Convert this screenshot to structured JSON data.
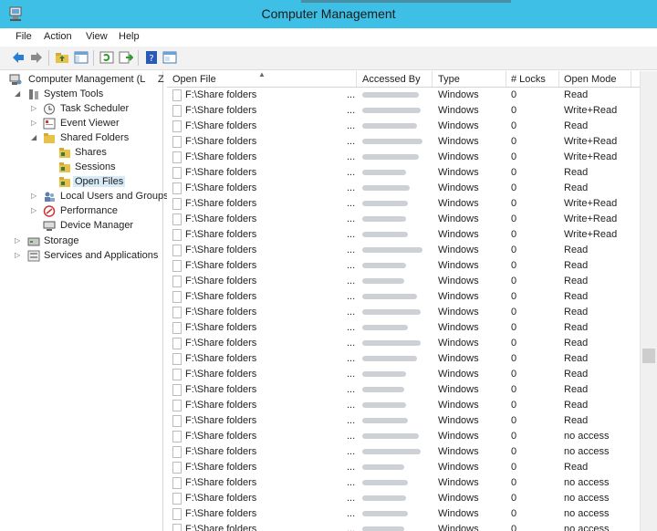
{
  "window": {
    "title": "Computer Management"
  },
  "menu": [
    "File",
    "Action",
    "View",
    "Help"
  ],
  "toolbar": {
    "icons": [
      "back-arrow-icon",
      "forward-arrow-icon",
      "up-folder-icon",
      "show-hide-tree-icon",
      "refresh-icon",
      "export-list-icon",
      "help-icon",
      "console-view-icon"
    ]
  },
  "tree": {
    "root": "Computer Management (L",
    "system_tools": "System Tools",
    "task_scheduler": "Task Scheduler",
    "event_viewer": "Event Viewer",
    "shared_folders": "Shared Folders",
    "shares": "Shares",
    "sessions": "Sessions",
    "open_files": "Open Files",
    "local_users": "Local Users and Groups",
    "performance": "Performance",
    "device_manager": "Device Manager",
    "storage": "Storage",
    "services": "Services and Applications"
  },
  "columns": {
    "open_file": "Open File",
    "accessed_by": "Accessed By",
    "type": "Type",
    "locks": "# Locks",
    "open_mode": "Open Mode",
    "clipped_marker": "Z"
  },
  "rows": [
    {
      "file": "F:\\Share folders",
      "dots": "...",
      "type": "Windows",
      "locks": "0",
      "mode": "Read"
    },
    {
      "file": "F:\\Share folders",
      "dots": "...",
      "type": "Windows",
      "locks": "0",
      "mode": "Write+Read"
    },
    {
      "file": "F:\\Share folders",
      "dots": "...",
      "type": "Windows",
      "locks": "0",
      "mode": "Read"
    },
    {
      "file": "F:\\Share folders",
      "dots": "...",
      "type": "Windows",
      "locks": "0",
      "mode": "Write+Read"
    },
    {
      "file": "F:\\Share folders",
      "dots": "...",
      "type": "Windows",
      "locks": "0",
      "mode": "Write+Read"
    },
    {
      "file": "F:\\Share folders",
      "dots": "...",
      "type": "Windows",
      "locks": "0",
      "mode": "Read"
    },
    {
      "file": "F:\\Share folders",
      "dots": "...",
      "type": "Windows",
      "locks": "0",
      "mode": "Read"
    },
    {
      "file": "F:\\Share folders",
      "dots": "...",
      "type": "Windows",
      "locks": "0",
      "mode": "Write+Read"
    },
    {
      "file": "F:\\Share folders",
      "dots": "...",
      "type": "Windows",
      "locks": "0",
      "mode": "Write+Read"
    },
    {
      "file": "F:\\Share folders",
      "dots": "...",
      "type": "Windows",
      "locks": "0",
      "mode": "Write+Read"
    },
    {
      "file": "F:\\Share folders",
      "dots": "...",
      "type": "Windows",
      "locks": "0",
      "mode": "Read"
    },
    {
      "file": "F:\\Share folders",
      "dots": "...",
      "type": "Windows",
      "locks": "0",
      "mode": "Read"
    },
    {
      "file": "F:\\Share folders",
      "dots": "...",
      "type": "Windows",
      "locks": "0",
      "mode": "Read"
    },
    {
      "file": "F:\\Share folders",
      "dots": "...",
      "type": "Windows",
      "locks": "0",
      "mode": "Read"
    },
    {
      "file": "F:\\Share folders",
      "dots": "...",
      "type": "Windows",
      "locks": "0",
      "mode": "Read"
    },
    {
      "file": "F:\\Share folders",
      "dots": "...",
      "type": "Windows",
      "locks": "0",
      "mode": "Read"
    },
    {
      "file": "F:\\Share folders",
      "dots": "...",
      "type": "Windows",
      "locks": "0",
      "mode": "Read"
    },
    {
      "file": "F:\\Share folders",
      "dots": "...",
      "type": "Windows",
      "locks": "0",
      "mode": "Read"
    },
    {
      "file": "F:\\Share folders",
      "dots": "...",
      "type": "Windows",
      "locks": "0",
      "mode": "Read"
    },
    {
      "file": "F:\\Share folders",
      "dots": "...",
      "type": "Windows",
      "locks": "0",
      "mode": "Read"
    },
    {
      "file": "F:\\Share folders",
      "dots": "...",
      "type": "Windows",
      "locks": "0",
      "mode": "Read"
    },
    {
      "file": "F:\\Share folders",
      "dots": "...",
      "type": "Windows",
      "locks": "0",
      "mode": "Read"
    },
    {
      "file": "F:\\Share folders",
      "dots": "...",
      "type": "Windows",
      "locks": "0",
      "mode": "no access"
    },
    {
      "file": "F:\\Share folders",
      "dots": "...",
      "type": "Windows",
      "locks": "0",
      "mode": "no access"
    },
    {
      "file": "F:\\Share folders",
      "dots": "...",
      "type": "Windows",
      "locks": "0",
      "mode": "Read"
    },
    {
      "file": "F:\\Share folders",
      "dots": "...",
      "type": "Windows",
      "locks": "0",
      "mode": "no access"
    },
    {
      "file": "F:\\Share folders",
      "dots": "...",
      "type": "Windows",
      "locks": "0",
      "mode": "no access"
    },
    {
      "file": "F:\\Share folders",
      "dots": "...",
      "type": "Windows",
      "locks": "0",
      "mode": "no access"
    },
    {
      "file": "F:\\Share folders",
      "dots": "...",
      "type": "Windows",
      "locks": "0",
      "mode": "no access"
    }
  ]
}
